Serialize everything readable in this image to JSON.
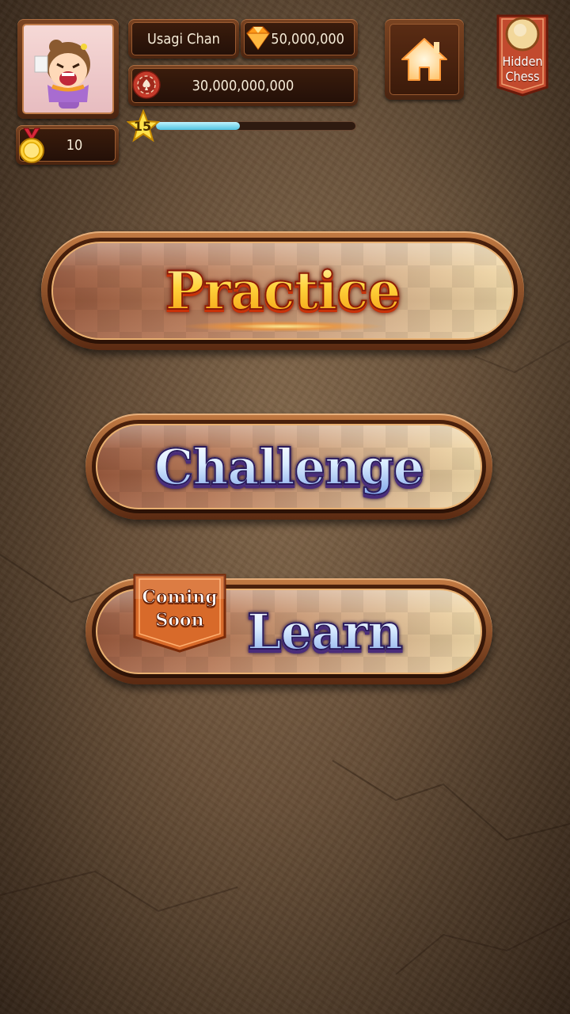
{
  "player": {
    "name": "Usagi Chan",
    "gems": "50,000,000",
    "chips": "30,000,000,000",
    "medals": "10",
    "level": "15",
    "xp_fraction": 0.42
  },
  "top_right": {
    "hidden_chess_line1": "Hidden",
    "hidden_chess_line2": "Chess"
  },
  "menu": {
    "practice": "Practice",
    "challenge": "Challenge",
    "learn": "Learn",
    "coming_soon_line1": "Coming",
    "coming_soon_line2": "Soon"
  },
  "icons": {
    "gem": "gem-icon",
    "chip": "poker-chip-icon",
    "medal": "medal-icon",
    "star": "star-icon",
    "home": "home-icon"
  },
  "colors": {
    "accent_gold": "#ffd23a",
    "xp_fill": "#4ec3e0",
    "wood_dark": "#3a1c0c"
  }
}
